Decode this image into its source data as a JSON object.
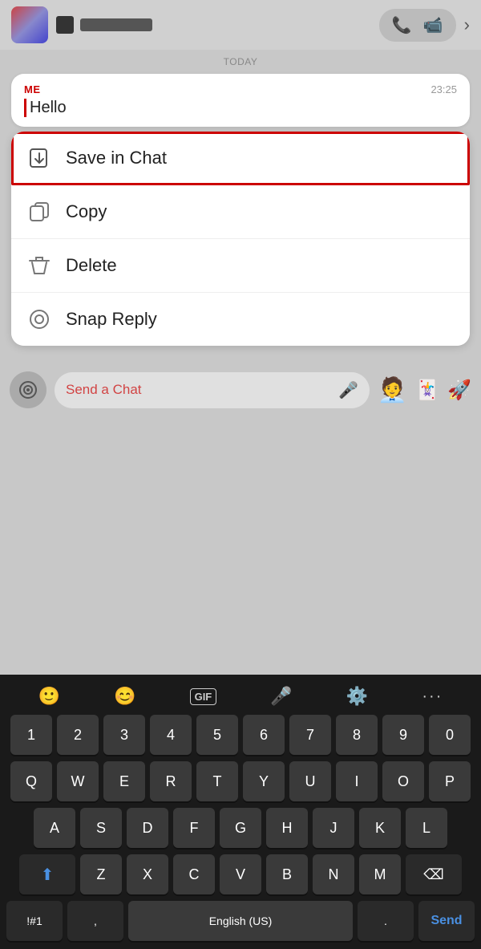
{
  "header": {
    "name_bar_placeholder": "Name",
    "phone_icon": "📞",
    "video_icon": "📹",
    "chevron": "›"
  },
  "chat": {
    "today_label": "TODAY",
    "message": {
      "sender": "ME",
      "time": "23:25",
      "text": "Hello"
    }
  },
  "context_menu": {
    "items": [
      {
        "label": "Save in Chat",
        "icon": "save",
        "highlighted": true
      },
      {
        "label": "Copy",
        "icon": "copy",
        "highlighted": false
      },
      {
        "label": "Delete",
        "icon": "delete",
        "highlighted": false
      },
      {
        "label": "Snap Reply",
        "icon": "snap",
        "highlighted": false
      }
    ]
  },
  "input_bar": {
    "placeholder": "Send a Chat"
  },
  "keyboard": {
    "toolbar": {
      "emoji_icon": "🙂",
      "face_icon": "😊",
      "gif_label": "GIF",
      "mic_icon": "🎤",
      "gear_icon": "⚙️",
      "dots": "···"
    },
    "rows": [
      [
        "1",
        "2",
        "3",
        "4",
        "5",
        "6",
        "7",
        "8",
        "9",
        "0"
      ],
      [
        "Q",
        "W",
        "E",
        "R",
        "T",
        "Y",
        "U",
        "I",
        "O",
        "P"
      ],
      [
        "A",
        "S",
        "D",
        "F",
        "G",
        "H",
        "J",
        "K",
        "L"
      ],
      [
        "Z",
        "X",
        "C",
        "V",
        "B",
        "N",
        "M"
      ],
      [
        "!#1",
        ",",
        "English (US)",
        ".",
        "Send"
      ]
    ]
  }
}
